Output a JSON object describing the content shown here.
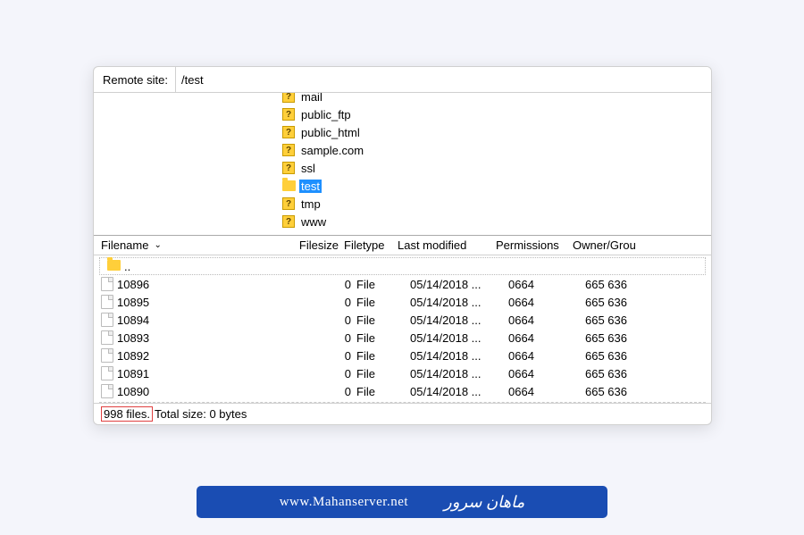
{
  "address_bar": {
    "label": "Remote site:",
    "value": "/test"
  },
  "tree": {
    "items": [
      {
        "icon": "question",
        "label": "mail",
        "cut": true
      },
      {
        "icon": "question",
        "label": "public_ftp"
      },
      {
        "icon": "question",
        "label": "public_html"
      },
      {
        "icon": "question",
        "label": "sample.com"
      },
      {
        "icon": "question",
        "label": "ssl"
      },
      {
        "icon": "folder",
        "label": "test",
        "selected": true
      },
      {
        "icon": "question",
        "label": "tmp"
      },
      {
        "icon": "question",
        "label": "www"
      }
    ]
  },
  "columns": {
    "name": "Filename",
    "size": "Filesize",
    "type": "Filetype",
    "modified": "Last modified",
    "permissions": "Permissions",
    "owner": "Owner/Grou"
  },
  "parent_dir": "..",
  "files": [
    {
      "name": "10896",
      "size": "0",
      "type": "File",
      "modified": "05/14/2018 ...",
      "perm": "0664",
      "owner": "665 636"
    },
    {
      "name": "10895",
      "size": "0",
      "type": "File",
      "modified": "05/14/2018 ...",
      "perm": "0664",
      "owner": "665 636"
    },
    {
      "name": "10894",
      "size": "0",
      "type": "File",
      "modified": "05/14/2018 ...",
      "perm": "0664",
      "owner": "665 636"
    },
    {
      "name": "10893",
      "size": "0",
      "type": "File",
      "modified": "05/14/2018 ...",
      "perm": "0664",
      "owner": "665 636"
    },
    {
      "name": "10892",
      "size": "0",
      "type": "File",
      "modified": "05/14/2018 ...",
      "perm": "0664",
      "owner": "665 636"
    },
    {
      "name": "10891",
      "size": "0",
      "type": "File",
      "modified": "05/14/2018 ...",
      "perm": "0664",
      "owner": "665 636"
    },
    {
      "name": "10890",
      "size": "0",
      "type": "File",
      "modified": "05/14/2018 ...",
      "perm": "0664",
      "owner": "665 636"
    }
  ],
  "status": {
    "count": "998 files.",
    "size": " Total size: 0 bytes"
  },
  "banner": {
    "url": "www.Mahanserver.net",
    "logo": "ماهان سرور"
  }
}
